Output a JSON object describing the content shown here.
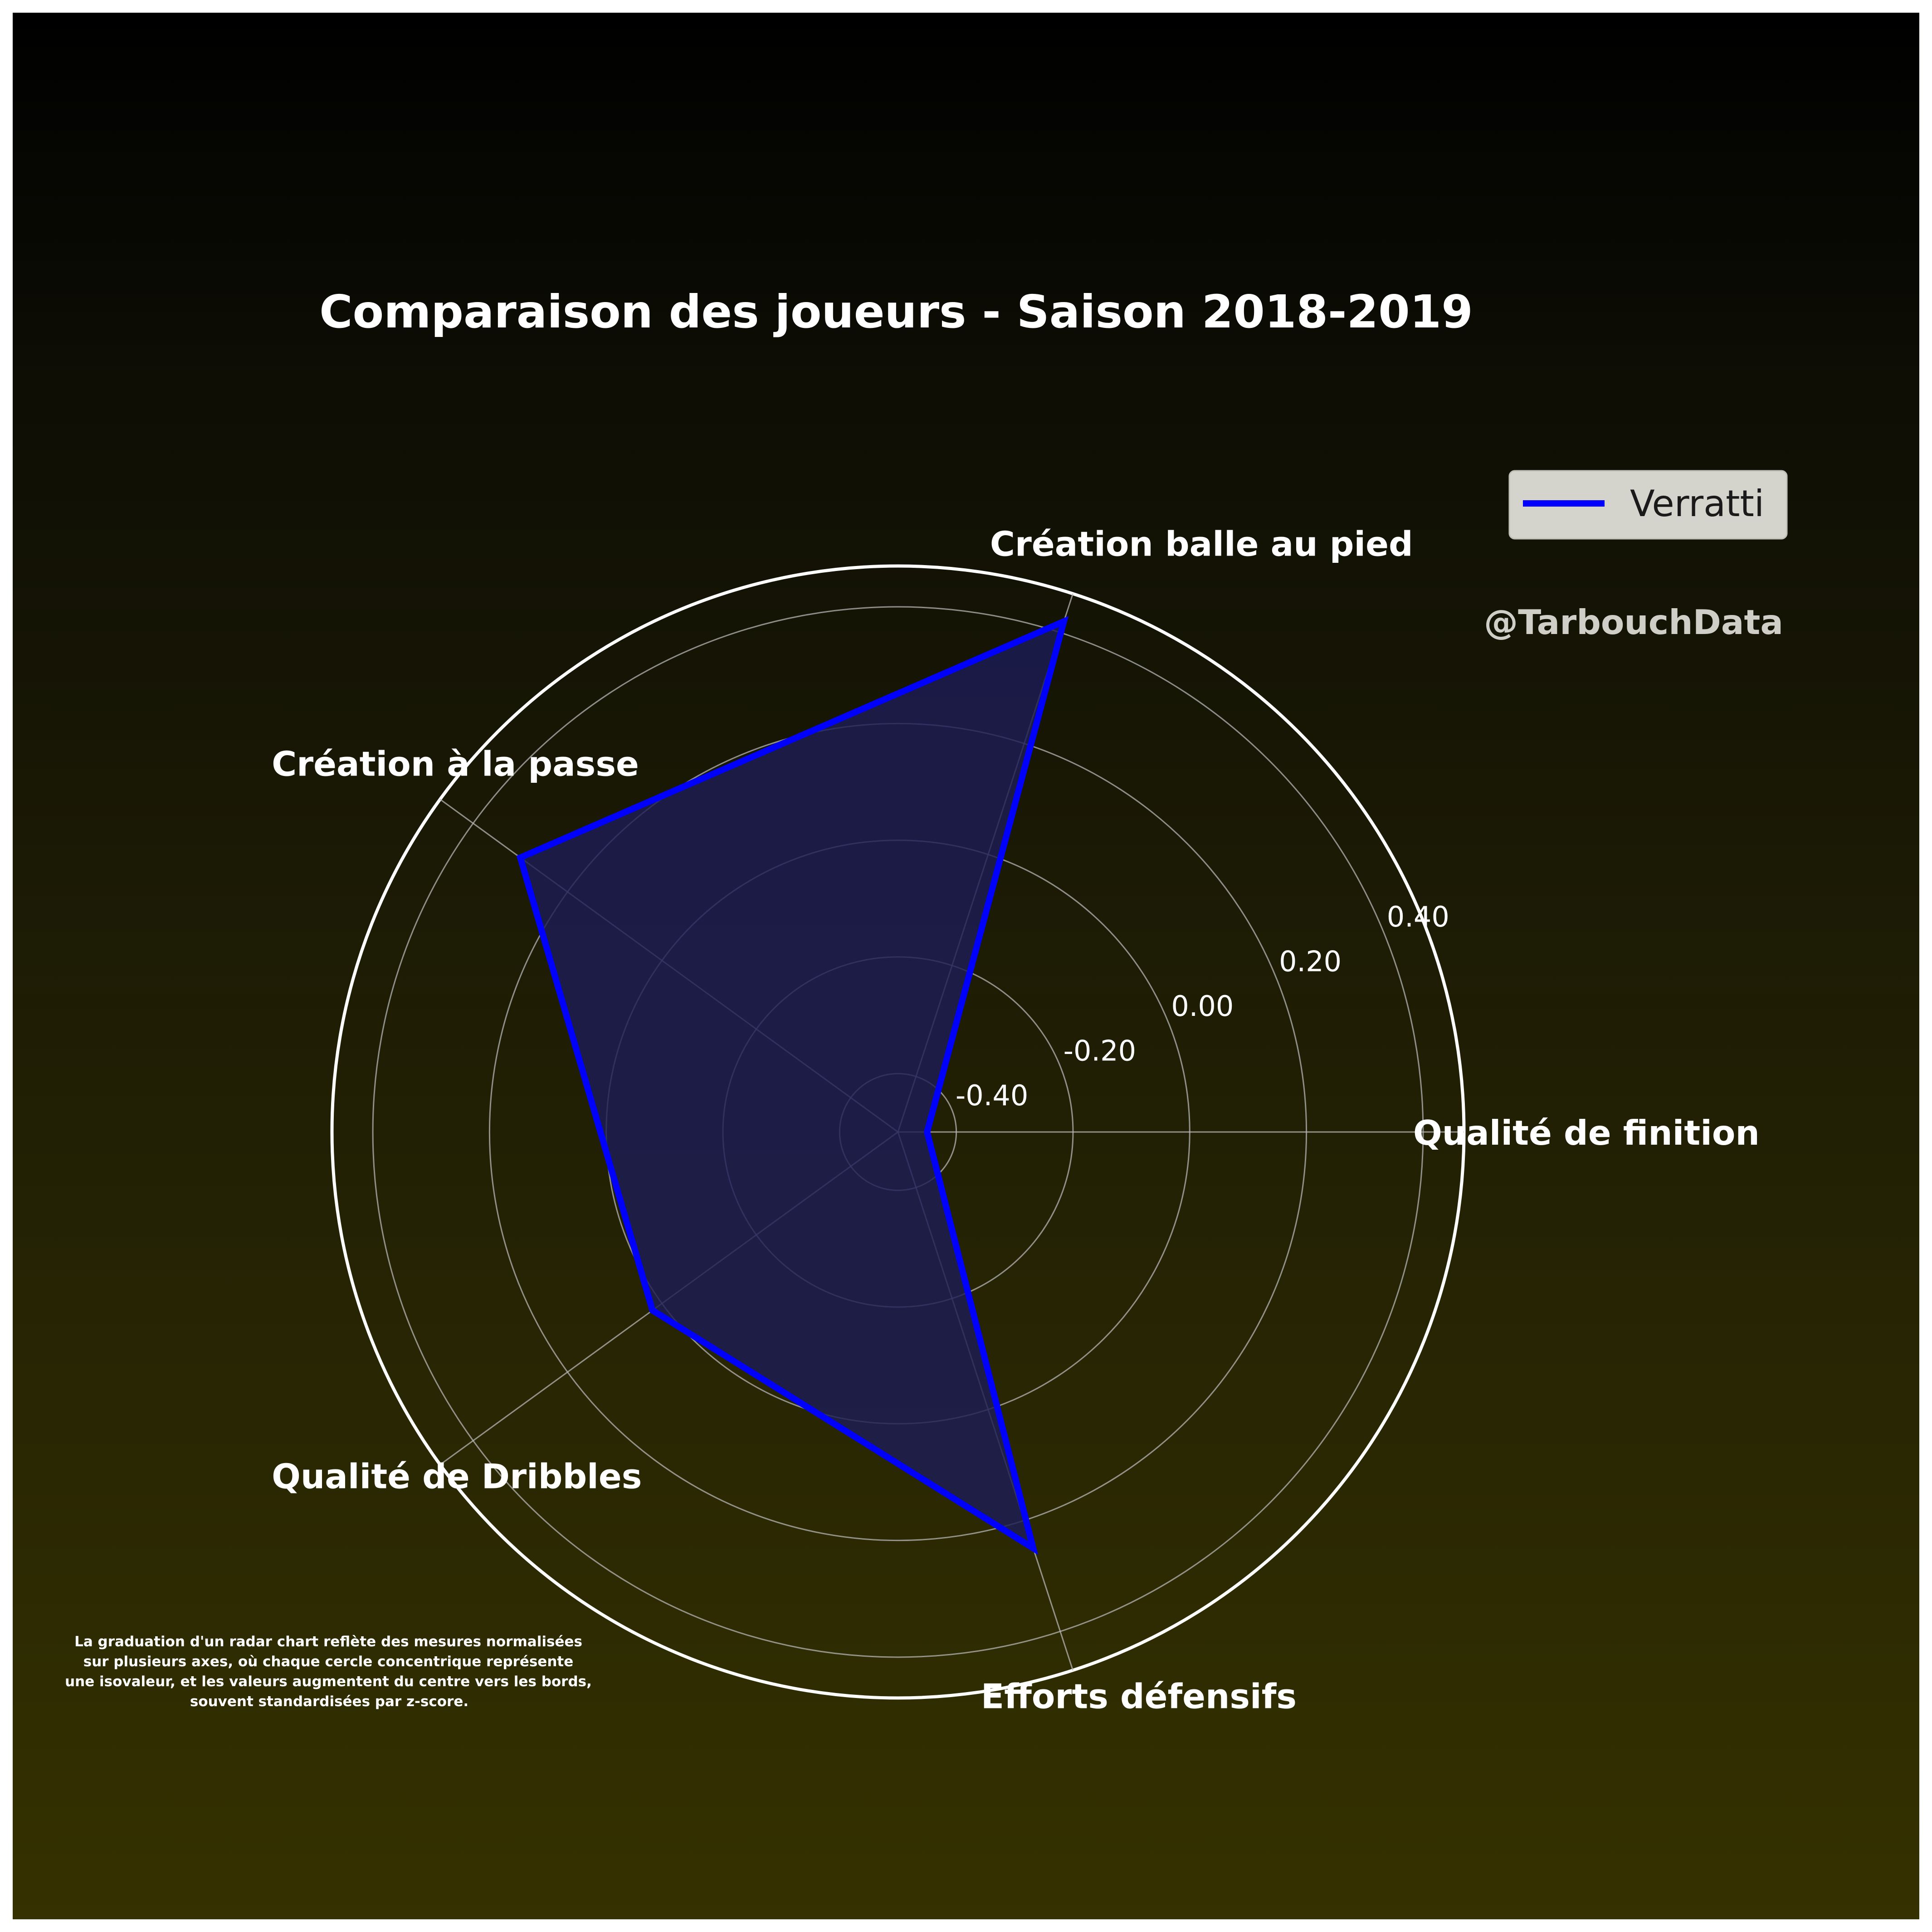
{
  "chart_data": {
    "type": "radar",
    "title": "Comparaison des joueurs - Saison 2018-2019",
    "axes": [
      "Qualité de finition",
      "Création balle au pied",
      "Création à la passe",
      "Qualité de Dribbles",
      "Efforts défensifs"
    ],
    "rlim": [
      -0.5,
      0.47
    ],
    "ticks": [
      -0.4,
      -0.2,
      0.0,
      0.2,
      0.4
    ],
    "tick_labels": [
      "-0.40",
      "-0.20",
      "0.00",
      "0.20",
      "0.40"
    ],
    "grid": true,
    "series": [
      {
        "name": "Verratti",
        "values": [
          -0.45,
          0.42,
          0.3,
          0.02,
          0.25
        ],
        "color": "#0000ff"
      }
    ],
    "legend": {
      "position": "top-right",
      "labels": [
        "Verratti"
      ]
    },
    "watermark": "@TarbouchData",
    "note_lines": [
      "La graduation d'un radar chart reflète des mesures normalisées",
      "sur plusieurs axes, où chaque cercle concentrique représente",
      "une isovaleur, et les valeurs augmentent du centre vers les bords,",
      "souvent standardisées par z-score."
    ],
    "colors": {
      "fill": "#1c1c55",
      "line": "#0000ff",
      "grid": "#b5b5b5",
      "outline": "#ffffff"
    }
  }
}
